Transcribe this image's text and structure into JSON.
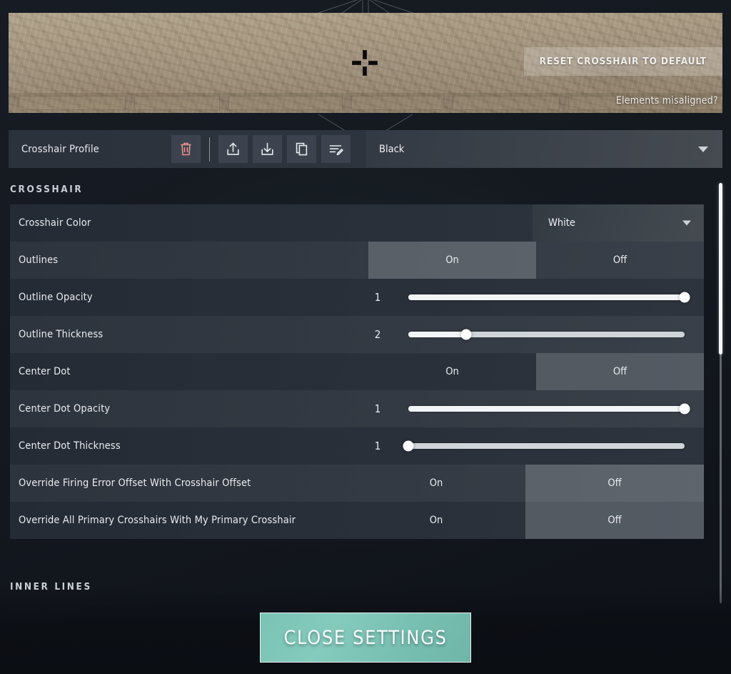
{
  "preview": {
    "reset_button_label": "RESET CROSSHAIR TO DEFAULT",
    "misaligned_link": "Elements misaligned?",
    "crosshair_icon": "crosshair-preview"
  },
  "profile_bar": {
    "label": "Crosshair Profile",
    "selected_profile": "Black",
    "icons": [
      {
        "name": "delete-icon",
        "tip": "Delete"
      },
      {
        "name": "export-icon",
        "tip": "Export"
      },
      {
        "name": "import-icon",
        "tip": "Import"
      },
      {
        "name": "duplicate-icon",
        "tip": "Duplicate"
      },
      {
        "name": "rename-icon",
        "tip": "Rename"
      }
    ]
  },
  "sections": {
    "crosshair": "CROSSHAIR",
    "inner_lines": "INNER LINES"
  },
  "toggle_options": {
    "on": "On",
    "off": "Off"
  },
  "settings": [
    {
      "label": "Crosshair Color",
      "type": "select",
      "value": "White"
    },
    {
      "label": "Outlines",
      "type": "toggle",
      "value": "On"
    },
    {
      "label": "Outline Opacity",
      "type": "slider",
      "value": "1",
      "percent": 100
    },
    {
      "label": "Outline Thickness",
      "type": "slider",
      "value": "2",
      "percent": 21
    },
    {
      "label": "Center Dot",
      "type": "toggle",
      "value": "Off"
    },
    {
      "label": "Center Dot Opacity",
      "type": "slider",
      "value": "1",
      "percent": 100
    },
    {
      "label": "Center Dot Thickness",
      "type": "slider",
      "value": "1",
      "percent": 0
    },
    {
      "label": "Override Firing Error Offset With Crosshair Offset",
      "type": "toggle",
      "value": "Off"
    },
    {
      "label": "Override All Primary Crosshairs With My Primary Crosshair",
      "type": "toggle",
      "value": "Off"
    }
  ],
  "footer": {
    "close_label": "CLOSE SETTINGS"
  },
  "colors": {
    "accent_teal": "#7ec5b7",
    "delete_red": "#e8908f",
    "row_dark": "#252b35",
    "row_light": "#323842",
    "text": "#e9ecef"
  }
}
